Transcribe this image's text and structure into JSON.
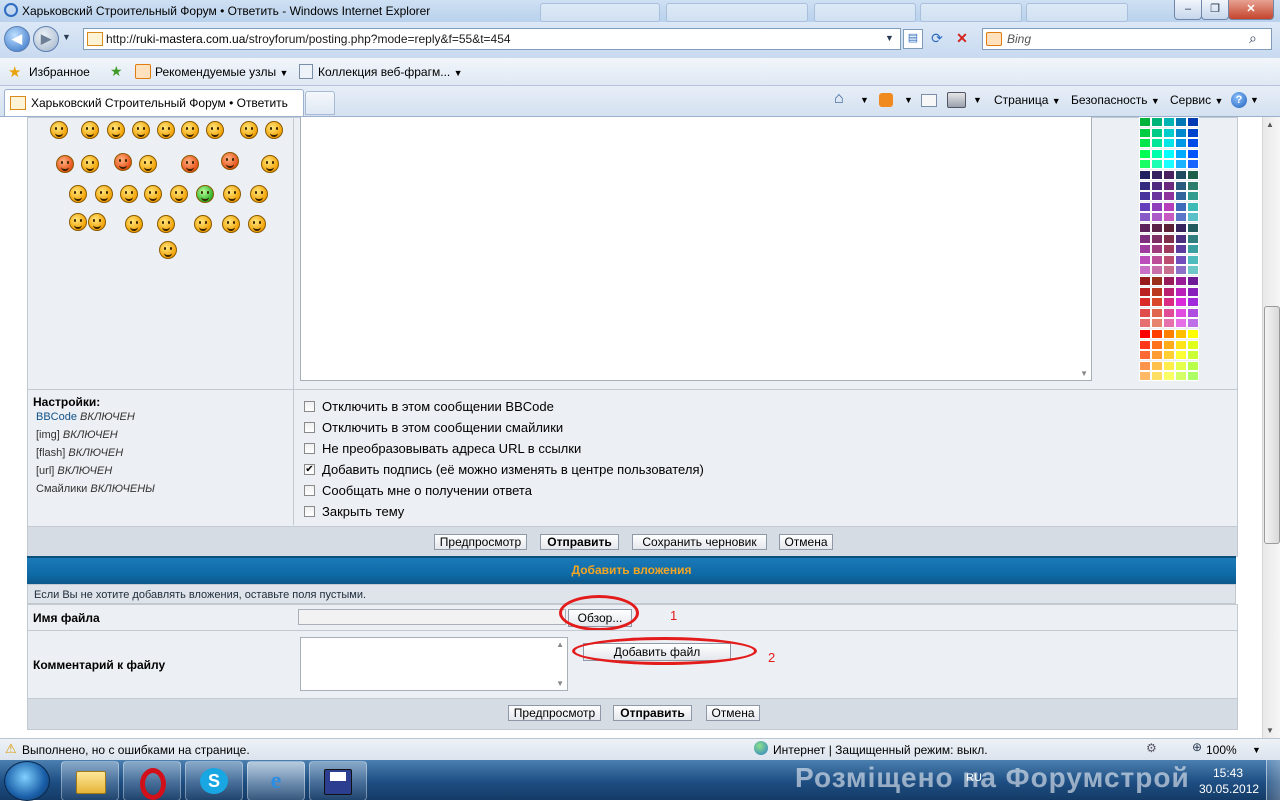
{
  "window": {
    "title": "Харьковский Строительный Форум • Ответить - Windows Internet Explorer",
    "minimize": "–",
    "restore": "❐",
    "close": "✕"
  },
  "address": {
    "url_prefix": "http://",
    "url_host": "ruki-mastera.com.ua",
    "url_path": "/stroyforum/posting.php?mode=reply&f=55&t=454",
    "search_placeholder": "Bing"
  },
  "favorites": {
    "label": "Избранное",
    "items": [
      "Рекомендуемые узлы",
      "Коллекция веб-фрагм..."
    ]
  },
  "tab": {
    "label": "Харьковский Строительный Форум • Ответить"
  },
  "commands": [
    "Страница",
    "Безопасность",
    "Сервис"
  ],
  "settings": {
    "title": "Настройки:",
    "lines": [
      {
        "name": "BBCode",
        "state": "ВКЛЮЧЕН"
      },
      {
        "name": "[img]",
        "state": "ВКЛЮЧЕН"
      },
      {
        "name": "[flash]",
        "state": "ВКЛЮЧЕН"
      },
      {
        "name": "[url]",
        "state": "ВКЛЮЧЕН"
      },
      {
        "name": "Смайлики",
        "state": "ВКЛЮЧЕНЫ"
      }
    ]
  },
  "options": [
    {
      "label": "Отключить в этом сообщении BBCode",
      "checked": false
    },
    {
      "label": "Отключить в этом сообщении смайлики",
      "checked": false
    },
    {
      "label": "Не преобразовывать адреса URL в ссылки",
      "checked": false
    },
    {
      "label": "Добавить подпись (её можно изменять в центре пользователя)",
      "checked": true
    },
    {
      "label": "Сообщать мне о получении ответа",
      "checked": false
    },
    {
      "label": "Закрыть тему",
      "checked": false
    }
  ],
  "buttons": {
    "preview": "Предпросмотр",
    "submit": "Отправить",
    "save_draft": "Сохранить черновик",
    "cancel": "Отмена"
  },
  "attachments": {
    "header": "Добавить вложения",
    "hint": "Если Вы не хотите добавлять вложения, оставьте поля пустыми.",
    "filename_label": "Имя файла",
    "browse": "Обзор...",
    "comment_label": "Комментарий к файлу",
    "add_file": "Добавить файл",
    "annotation_1": "1",
    "annotation_2": "2"
  },
  "status": {
    "message": "Выполнено, но с ошибками на странице.",
    "zone": "Интернет | Защищенный режим: выкл.",
    "zoom": "100%"
  },
  "taskbar": {
    "lang": "RU",
    "time": "15:43",
    "date": "30.05.2012",
    "watermark": "Розміщено на Форумстрой"
  },
  "colors": {
    "accent_header": "#0f6aa6",
    "header_text": "#f5a623",
    "annotation": "#e41b1b"
  }
}
